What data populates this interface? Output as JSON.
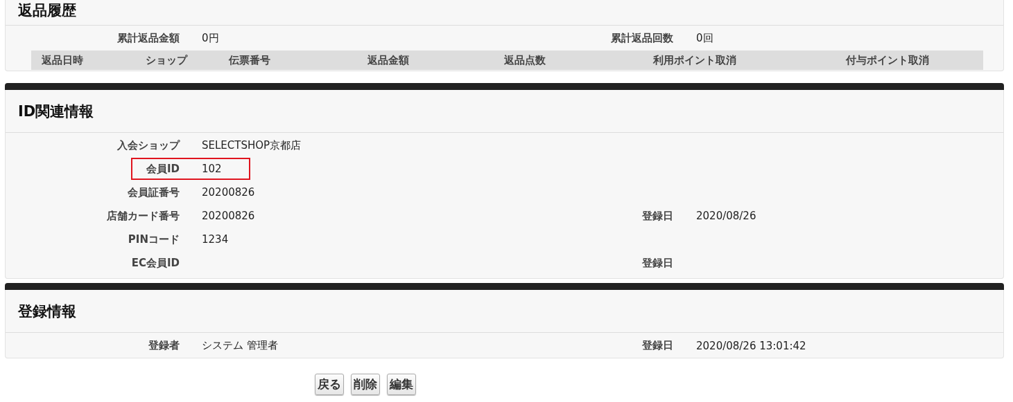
{
  "return_history": {
    "title": "返品履歴",
    "summary": [
      {
        "label": "累計返品金額",
        "value": "0円",
        "side": {
          "label": "累計返品回数",
          "value": "0回"
        }
      }
    ],
    "table": {
      "columns": [
        "返品日時",
        "ショップ",
        "伝票番号",
        "返品金額",
        "返品点数",
        "利用ポイント取消",
        "付与ポイント取消"
      ]
    }
  },
  "id_info": {
    "title": "ID関連情報",
    "rows": [
      {
        "label": "入会ショップ",
        "value": "SELECTSHOP京都店",
        "highlighted": false
      },
      {
        "label": "会員ID",
        "value": "102",
        "highlighted": true
      },
      {
        "label": "会員証番号",
        "value": "20200826",
        "highlighted": false
      },
      {
        "label": "店舗カード番号",
        "value": "20200826",
        "highlighted": false,
        "side": {
          "label": "登録日",
          "value": "2020/08/26"
        }
      },
      {
        "label": "PINコード",
        "value": "1234",
        "highlighted": false
      },
      {
        "label": "EC会員ID",
        "highlighted": false,
        "side": {
          "label": "登録日"
        }
      }
    ]
  },
  "registration": {
    "title": "登録情報",
    "rows": [
      {
        "label": "登録者",
        "value": "システム 管理者",
        "side": {
          "label": "登録日",
          "value": "2020/08/26 13:01:42"
        }
      }
    ]
  },
  "buttons": [
    "戻る",
    "削除",
    "編集"
  ]
}
